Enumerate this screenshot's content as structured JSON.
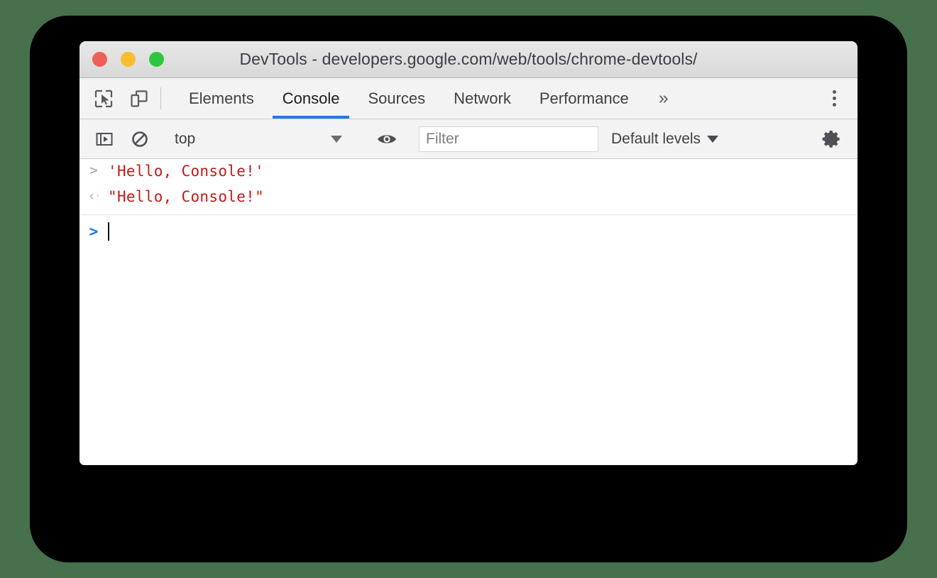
{
  "window": {
    "title": "DevTools - developers.google.com/web/tools/chrome-devtools/",
    "traffic_lights": [
      {
        "name": "close",
        "color": "#ee5f56"
      },
      {
        "name": "minimize",
        "color": "#f7bd2e"
      },
      {
        "name": "zoom",
        "color": "#2fc63f"
      }
    ]
  },
  "toolbar": {
    "inspect_icon": "inspect-element-icon",
    "device_icon": "device-toolbar-icon",
    "overflow_label": "»",
    "menu_icon": "more-options-icon",
    "tabs": [
      {
        "label": "Elements",
        "active": false
      },
      {
        "label": "Console",
        "active": true
      },
      {
        "label": "Sources",
        "active": false
      },
      {
        "label": "Network",
        "active": false
      },
      {
        "label": "Performance",
        "active": false
      }
    ],
    "active_tab_color": "#2578f0"
  },
  "console_toolbar": {
    "sidebar_icon": "console-sidebar-icon",
    "clear_icon": "clear-console-icon",
    "context": {
      "value": "top",
      "caret": "▼"
    },
    "eye_icon": "live-expression-eye-icon",
    "filter": {
      "value": "",
      "placeholder": "Filter"
    },
    "levels": {
      "label": "Default levels",
      "caret": "▼"
    },
    "settings_icon": "settings-gear-icon"
  },
  "console": {
    "messages": [
      {
        "gutter": ">",
        "type": "input",
        "text": "'Hello, Console!'"
      },
      {
        "gutter": "‹",
        "type": "result",
        "text": "\"Hello, Console!\""
      }
    ],
    "prompt": {
      "gutter": ">",
      "value": ""
    },
    "string_color": "#c41a16",
    "prompt_color": "#1a73e8"
  }
}
